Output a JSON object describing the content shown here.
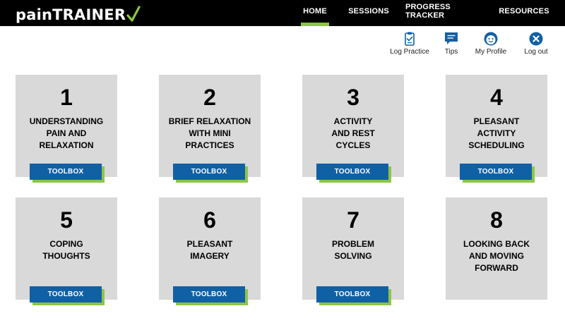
{
  "brand": {
    "name": "painTRAINER",
    "accent_color": "#8dc63f"
  },
  "nav": {
    "home": "HOME",
    "sessions": "SESSIONS",
    "progress": "PROGRESS TRACKER",
    "resources": "RESOURCES",
    "active": "HOME"
  },
  "utility": {
    "log_practice": {
      "label": "Log Practice",
      "icon": "clipboard-icon"
    },
    "tips": {
      "label": "Tips",
      "icon": "chat-bubble-icon"
    },
    "profile": {
      "label": "My Profile",
      "icon": "smiley-icon"
    },
    "logout": {
      "label": "Log out",
      "icon": "close-circle-icon"
    }
  },
  "button_color": "#1060a6",
  "sessions": [
    {
      "number": "1",
      "title_lines": [
        "UNDERSTANDING",
        "PAIN AND",
        "RELAXATION"
      ],
      "toolbox": "TOOLBOX"
    },
    {
      "number": "2",
      "title_lines": [
        "BRIEF RELAXATION",
        "WITH MINI",
        "PRACTICES"
      ],
      "toolbox": "TOOLBOX"
    },
    {
      "number": "3",
      "title_lines": [
        "ACTIVITY",
        "AND REST",
        "CYCLES"
      ],
      "toolbox": "TOOLBOX"
    },
    {
      "number": "4",
      "title_lines": [
        "PLEASANT",
        "ACTIVITY",
        "SCHEDULING"
      ],
      "toolbox": "TOOLBOX"
    },
    {
      "number": "5",
      "title_lines": [
        "COPING",
        "THOUGHTS"
      ],
      "toolbox": "TOOLBOX"
    },
    {
      "number": "6",
      "title_lines": [
        "PLEASANT",
        "IMAGERY"
      ],
      "toolbox": "TOOLBOX"
    },
    {
      "number": "7",
      "title_lines": [
        "PROBLEM",
        "SOLVING"
      ],
      "toolbox": "TOOLBOX"
    },
    {
      "number": "8",
      "title_lines": [
        "LOOKING BACK",
        "AND MOVING",
        "FORWARD"
      ],
      "toolbox": ""
    }
  ]
}
